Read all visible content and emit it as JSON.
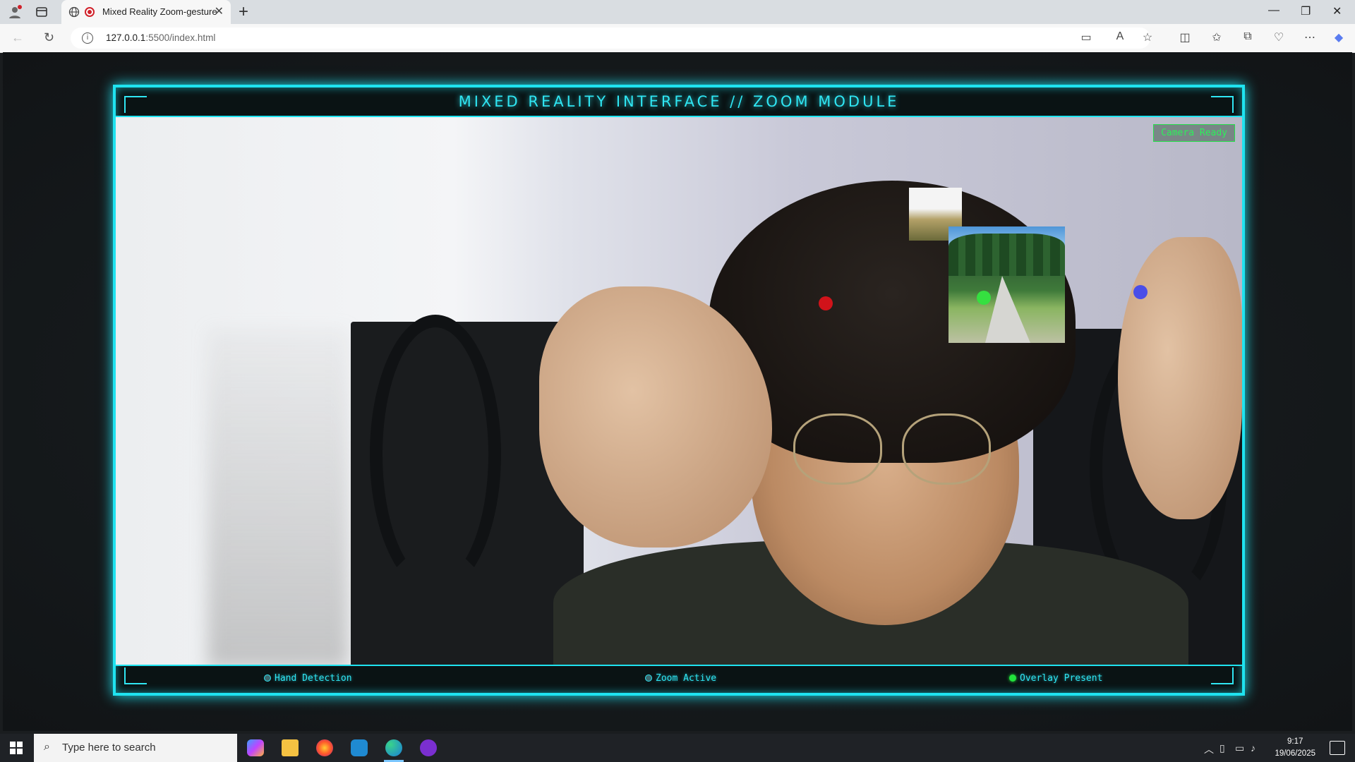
{
  "browser": {
    "tab_title": "Mixed Reality Zoom-gesture",
    "url_host": "127.0.0.1",
    "url_rest": ":5500/index.html"
  },
  "app": {
    "header_title": "MIXED REALITY INTERFACE // ZOOM MODULE",
    "camera_status": "Camera Ready",
    "status_items": [
      {
        "label": "Hand Detection",
        "active": false
      },
      {
        "label": "Zoom Active",
        "active": false
      },
      {
        "label": "Overlay Present",
        "active": true
      }
    ],
    "colors": {
      "accent": "#1fe3f0",
      "ok": "#22e23c",
      "marker_red": "#d1131a",
      "marker_green": "#35e040",
      "marker_blue": "#4a4ee8"
    }
  },
  "taskbar": {
    "search_placeholder": "Type here to search",
    "time": "9:17",
    "date": "19/06/2025",
    "apps": [
      "copilot-icon",
      "file-explorer-icon",
      "firefox-icon",
      "vscode-icon",
      "edge-icon",
      "mixed-reality-app-icon"
    ]
  }
}
